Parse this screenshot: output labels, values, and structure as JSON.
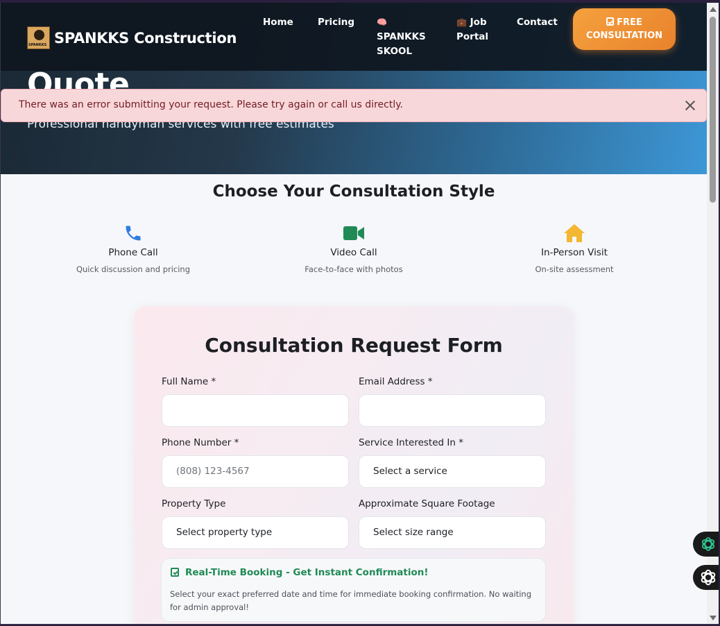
{
  "hero": {
    "title": "Quote",
    "subtitle": "Professional handyman services with free estimates"
  },
  "nav": {
    "brand": "SPANKKS Construction",
    "logo_text": "SPANKKS",
    "links": {
      "home": "Home",
      "pricing": "Pricing",
      "skool_line1": "SPANKKS",
      "skool_line2": "SKOOL",
      "skool_emoji": "🧠",
      "job_emoji": "💼",
      "job_line1": "Job",
      "job_line2": "Portal",
      "contact": "Contact"
    },
    "cta_line1": "FREE",
    "cta_line2": "CONSULTATION"
  },
  "alert": {
    "message": "There was an error submitting your request. Please try again or call us directly."
  },
  "consultation": {
    "title": "Choose Your Consultation Style",
    "options": [
      {
        "label": "Phone Call",
        "desc": "Quick discussion and pricing",
        "icon": "phone-icon",
        "color": "#2f7de1"
      },
      {
        "label": "Video Call",
        "desc": "Face-to-face with photos",
        "icon": "video-camera-icon",
        "color": "#1f8a55"
      },
      {
        "label": "In-Person Visit",
        "desc": "On-site assessment",
        "icon": "home-icon",
        "color": "#f4b731"
      }
    ]
  },
  "form": {
    "title": "Consultation Request Form",
    "full_name_label": "Full Name *",
    "full_name_value": "",
    "email_label": "Email Address *",
    "email_value": "",
    "phone_label": "Phone Number *",
    "phone_placeholder": "(808) 123-4567",
    "service_label": "Service Interested In *",
    "service_value": "Select a service",
    "property_label": "Property Type",
    "property_value": "Select property type",
    "sqft_label": "Approximate Square Footage",
    "sqft_value": "Select size range",
    "booking_title": "Real-Time Booking - Get Instant Confirmation!",
    "booking_text": "Select your exact preferred date and time for immediate booking confirmation. No waiting for admin approval!"
  },
  "colors": {
    "accent_orange": "#f0922f",
    "alert_bg": "#f8d7da",
    "success_green": "#1f8a55"
  }
}
